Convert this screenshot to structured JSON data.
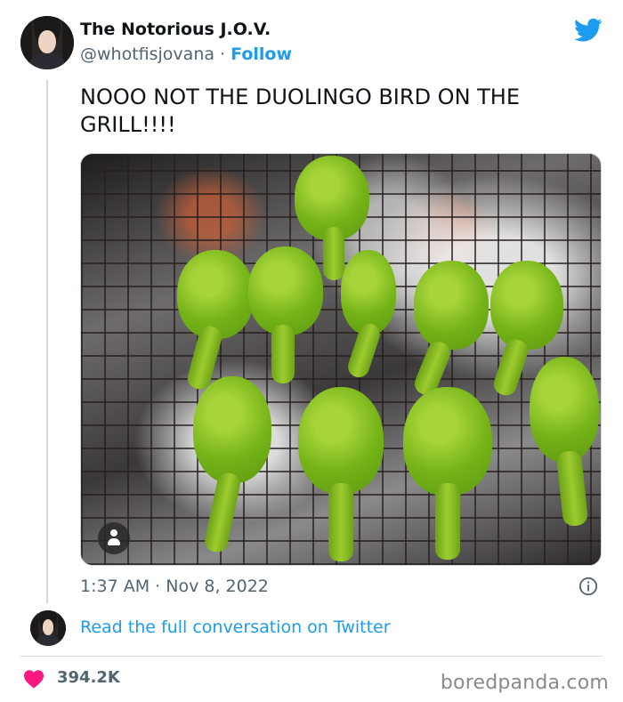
{
  "author": {
    "name": "The Notorious J.O.V.",
    "handle": "@whotfisjovana",
    "separator": "·",
    "follow_label": "Follow"
  },
  "tweet": {
    "text": "NOOO NOT THE DUOLINGO BIRD ON THE GRILL!!!!",
    "time": "1:37 AM",
    "date_separator": "·",
    "date": "Nov 8, 2022",
    "image_alt": "Green marinated chicken drumsticks on a grill"
  },
  "footer": {
    "read_conversation_label": "Read the full conversation on Twitter",
    "likes": "394.2K"
  },
  "watermark": "boredpanda.com",
  "colors": {
    "accent": "#1d9bf0",
    "text": "#0f1419",
    "muted": "#536471",
    "heart": "#f91880"
  },
  "icons": [
    "twitter-bird-icon",
    "info-icon",
    "heart-icon",
    "person-icon"
  ]
}
